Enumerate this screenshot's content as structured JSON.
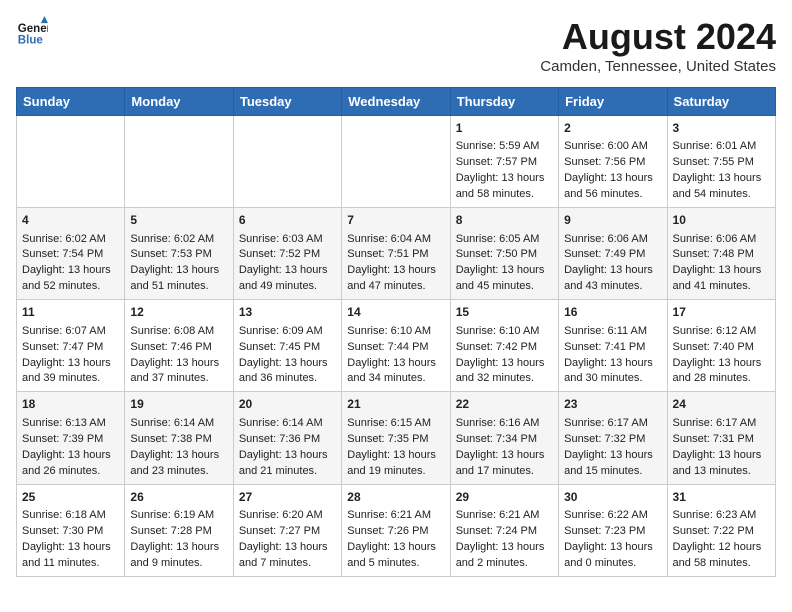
{
  "header": {
    "logo_line1": "General",
    "logo_line2": "Blue",
    "month_year": "August 2024",
    "location": "Camden, Tennessee, United States"
  },
  "weekdays": [
    "Sunday",
    "Monday",
    "Tuesday",
    "Wednesday",
    "Thursday",
    "Friday",
    "Saturday"
  ],
  "weeks": [
    [
      {
        "day": "",
        "info": ""
      },
      {
        "day": "",
        "info": ""
      },
      {
        "day": "",
        "info": ""
      },
      {
        "day": "",
        "info": ""
      },
      {
        "day": "1",
        "info": "Sunrise: 5:59 AM\nSunset: 7:57 PM\nDaylight: 13 hours\nand 58 minutes."
      },
      {
        "day": "2",
        "info": "Sunrise: 6:00 AM\nSunset: 7:56 PM\nDaylight: 13 hours\nand 56 minutes."
      },
      {
        "day": "3",
        "info": "Sunrise: 6:01 AM\nSunset: 7:55 PM\nDaylight: 13 hours\nand 54 minutes."
      }
    ],
    [
      {
        "day": "4",
        "info": "Sunrise: 6:02 AM\nSunset: 7:54 PM\nDaylight: 13 hours\nand 52 minutes."
      },
      {
        "day": "5",
        "info": "Sunrise: 6:02 AM\nSunset: 7:53 PM\nDaylight: 13 hours\nand 51 minutes."
      },
      {
        "day": "6",
        "info": "Sunrise: 6:03 AM\nSunset: 7:52 PM\nDaylight: 13 hours\nand 49 minutes."
      },
      {
        "day": "7",
        "info": "Sunrise: 6:04 AM\nSunset: 7:51 PM\nDaylight: 13 hours\nand 47 minutes."
      },
      {
        "day": "8",
        "info": "Sunrise: 6:05 AM\nSunset: 7:50 PM\nDaylight: 13 hours\nand 45 minutes."
      },
      {
        "day": "9",
        "info": "Sunrise: 6:06 AM\nSunset: 7:49 PM\nDaylight: 13 hours\nand 43 minutes."
      },
      {
        "day": "10",
        "info": "Sunrise: 6:06 AM\nSunset: 7:48 PM\nDaylight: 13 hours\nand 41 minutes."
      }
    ],
    [
      {
        "day": "11",
        "info": "Sunrise: 6:07 AM\nSunset: 7:47 PM\nDaylight: 13 hours\nand 39 minutes."
      },
      {
        "day": "12",
        "info": "Sunrise: 6:08 AM\nSunset: 7:46 PM\nDaylight: 13 hours\nand 37 minutes."
      },
      {
        "day": "13",
        "info": "Sunrise: 6:09 AM\nSunset: 7:45 PM\nDaylight: 13 hours\nand 36 minutes."
      },
      {
        "day": "14",
        "info": "Sunrise: 6:10 AM\nSunset: 7:44 PM\nDaylight: 13 hours\nand 34 minutes."
      },
      {
        "day": "15",
        "info": "Sunrise: 6:10 AM\nSunset: 7:42 PM\nDaylight: 13 hours\nand 32 minutes."
      },
      {
        "day": "16",
        "info": "Sunrise: 6:11 AM\nSunset: 7:41 PM\nDaylight: 13 hours\nand 30 minutes."
      },
      {
        "day": "17",
        "info": "Sunrise: 6:12 AM\nSunset: 7:40 PM\nDaylight: 13 hours\nand 28 minutes."
      }
    ],
    [
      {
        "day": "18",
        "info": "Sunrise: 6:13 AM\nSunset: 7:39 PM\nDaylight: 13 hours\nand 26 minutes."
      },
      {
        "day": "19",
        "info": "Sunrise: 6:14 AM\nSunset: 7:38 PM\nDaylight: 13 hours\nand 23 minutes."
      },
      {
        "day": "20",
        "info": "Sunrise: 6:14 AM\nSunset: 7:36 PM\nDaylight: 13 hours\nand 21 minutes."
      },
      {
        "day": "21",
        "info": "Sunrise: 6:15 AM\nSunset: 7:35 PM\nDaylight: 13 hours\nand 19 minutes."
      },
      {
        "day": "22",
        "info": "Sunrise: 6:16 AM\nSunset: 7:34 PM\nDaylight: 13 hours\nand 17 minutes."
      },
      {
        "day": "23",
        "info": "Sunrise: 6:17 AM\nSunset: 7:32 PM\nDaylight: 13 hours\nand 15 minutes."
      },
      {
        "day": "24",
        "info": "Sunrise: 6:17 AM\nSunset: 7:31 PM\nDaylight: 13 hours\nand 13 minutes."
      }
    ],
    [
      {
        "day": "25",
        "info": "Sunrise: 6:18 AM\nSunset: 7:30 PM\nDaylight: 13 hours\nand 11 minutes."
      },
      {
        "day": "26",
        "info": "Sunrise: 6:19 AM\nSunset: 7:28 PM\nDaylight: 13 hours\nand 9 minutes."
      },
      {
        "day": "27",
        "info": "Sunrise: 6:20 AM\nSunset: 7:27 PM\nDaylight: 13 hours\nand 7 minutes."
      },
      {
        "day": "28",
        "info": "Sunrise: 6:21 AM\nSunset: 7:26 PM\nDaylight: 13 hours\nand 5 minutes."
      },
      {
        "day": "29",
        "info": "Sunrise: 6:21 AM\nSunset: 7:24 PM\nDaylight: 13 hours\nand 2 minutes."
      },
      {
        "day": "30",
        "info": "Sunrise: 6:22 AM\nSunset: 7:23 PM\nDaylight: 13 hours\nand 0 minutes."
      },
      {
        "day": "31",
        "info": "Sunrise: 6:23 AM\nSunset: 7:22 PM\nDaylight: 12 hours\nand 58 minutes."
      }
    ]
  ]
}
